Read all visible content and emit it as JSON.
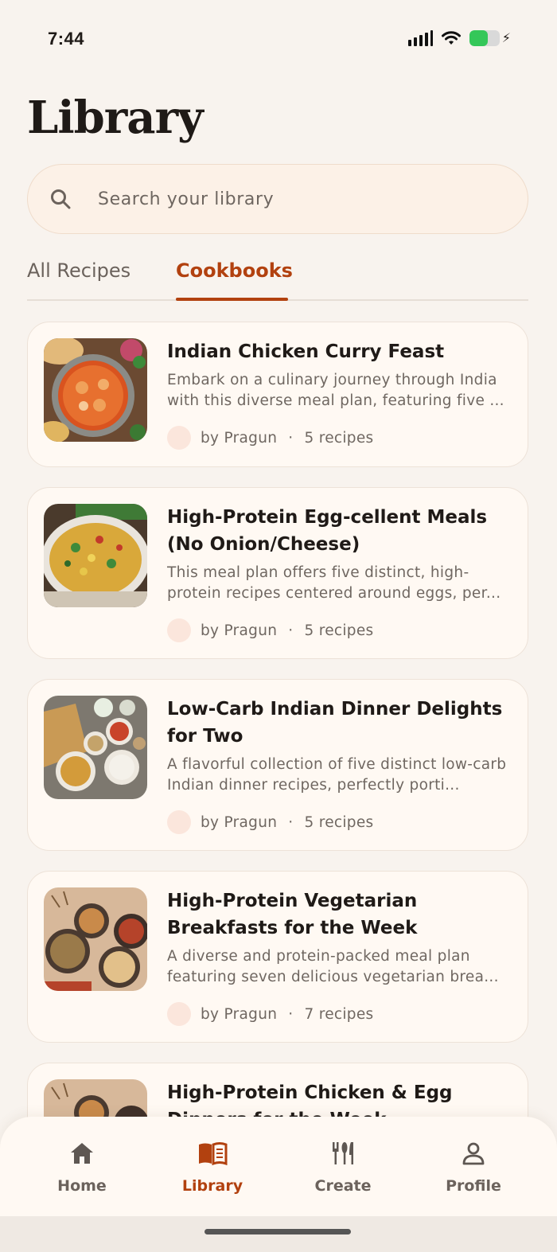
{
  "status": {
    "time": "7:44"
  },
  "page": {
    "title": "Library"
  },
  "search": {
    "placeholder": "Search your library"
  },
  "tabs": [
    {
      "label": "All Recipes",
      "active": false
    },
    {
      "label": "Cookbooks",
      "active": true
    }
  ],
  "cookbooks": [
    {
      "title": "Indian Chicken Curry Feast",
      "description": "Embark on a culinary journey through India with this diverse meal plan, featuring five ...",
      "author": "by Pragun",
      "count": "5 recipes",
      "image": "curry-bowl"
    },
    {
      "title": "High-Protein Egg-cellent Meals (No Onion/Cheese)",
      "description": "This meal plan offers five distinct, high-protein recipes centered around eggs, per...",
      "author": "by Pragun",
      "count": "5 recipes",
      "image": "egg-scramble-plate"
    },
    {
      "title": "Low-Carb Indian Dinner Delights for Two",
      "description": "A flavorful collection of five distinct low-carb Indian dinner recipes, perfectly porti...",
      "author": "by Pragun",
      "count": "5 recipes",
      "image": "dinner-bowls-spread"
    },
    {
      "title": "High-Protein Vegetarian Breakfasts for the Week",
      "description": "A diverse and protein-packed meal plan featuring seven delicious vegetarian brea...",
      "author": "by Pragun",
      "count": "7 recipes",
      "image": "breakfast-bowls"
    },
    {
      "title": "High-Protein Chicken & Egg Dinners for the Week",
      "description": "",
      "author": "",
      "count": "",
      "image": "breakfast-bowls"
    }
  ],
  "nav": [
    {
      "label": "Home",
      "icon": "home-icon",
      "active": false
    },
    {
      "label": "Library",
      "icon": "book-icon",
      "active": true
    },
    {
      "label": "Create",
      "icon": "utensils-icon",
      "active": false
    },
    {
      "label": "Profile",
      "icon": "person-icon",
      "active": false
    }
  ],
  "colors": {
    "accent": "#b2410f",
    "background": "#f8f3ee",
    "card": "#fff9f3"
  }
}
